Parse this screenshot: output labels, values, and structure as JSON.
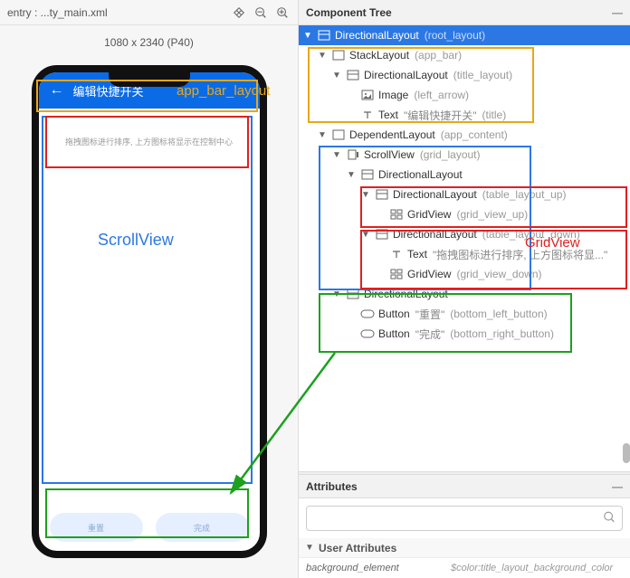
{
  "toolbar": {
    "path": "entry : ...ty_main.xml"
  },
  "size_label": "1080 x 2340 (P40)",
  "app_bar": {
    "title": "编辑快捷开关"
  },
  "hint_text": "拖拽图标进行排序, 上方图标将显示在控制中心",
  "buttons": {
    "left": "重置",
    "right": "完成"
  },
  "annotations": {
    "app_bar": "app_bar_layout",
    "scrollview": "ScrollView",
    "gridview": "GridView"
  },
  "panel": {
    "tree_header": "Component Tree",
    "attr_header": "Attributes",
    "user_attr_header": "User Attributes"
  },
  "tree": {
    "root": {
      "type": "DirectionalLayout",
      "id": "(root_layout)"
    },
    "stack": {
      "type": "StackLayout",
      "id": "(app_bar)"
    },
    "dir_title": {
      "type": "DirectionalLayout",
      "id": "(title_layout)"
    },
    "image": {
      "type": "Image",
      "id": "(left_arrow)"
    },
    "text_title": {
      "type": "Text",
      "quoted": "\"编辑快捷开关\"",
      "id": "(title)"
    },
    "dep": {
      "type": "DependentLayout",
      "id": "(app_content)"
    },
    "scroll": {
      "type": "ScrollView",
      "id": "(grid_layout)"
    },
    "dir_inner": {
      "type": "DirectionalLayout"
    },
    "dir_up": {
      "type": "DirectionalLayout",
      "id": "(table_layout_up)"
    },
    "grid_up": {
      "type": "GridView",
      "id": "(grid_view_up)"
    },
    "dir_down": {
      "type": "DirectionalLayout",
      "id": "(table_layout_down)"
    },
    "text_down": {
      "type": "Text",
      "quoted": "\"拖拽图标进行排序, 上方图标将显...\""
    },
    "grid_down": {
      "type": "GridView",
      "id": "(grid_view_down)"
    },
    "dir_btn": {
      "type": "DirectionalLayout"
    },
    "btn_left": {
      "type": "Button",
      "quoted": "\"重置\"",
      "id": "(bottom_left_button)"
    },
    "btn_right": {
      "type": "Button",
      "quoted": "\"完成\"",
      "id": "(bottom_right_button)"
    }
  },
  "attributes": {
    "row1": {
      "name": "background_element",
      "value": "$color:title_layout_background_color"
    }
  }
}
